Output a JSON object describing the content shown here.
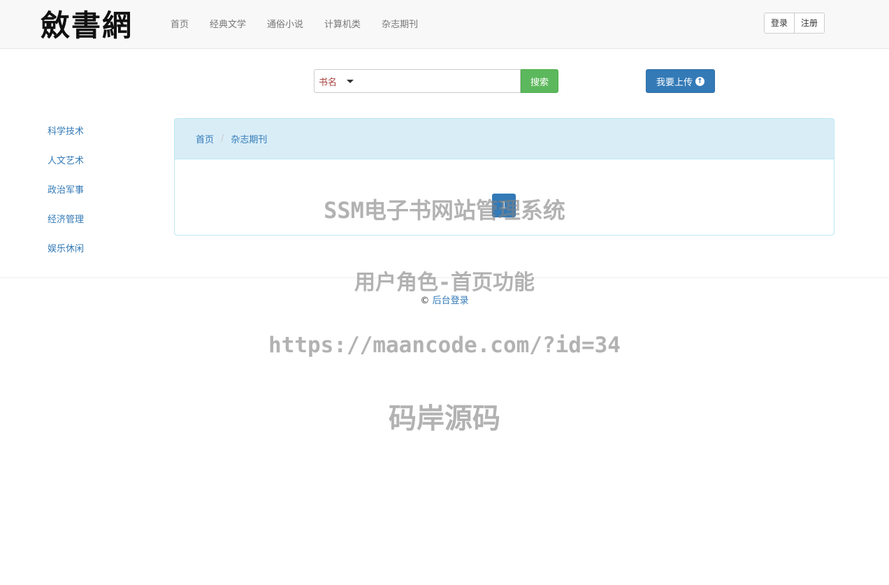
{
  "header": {
    "logo_text": "斂書網",
    "nav": [
      "首页",
      "经典文学",
      "通俗小说",
      "计算机类",
      "杂志期刊"
    ],
    "login_label": "登录",
    "register_label": "注册"
  },
  "search": {
    "type_label": "书名",
    "input_value": "",
    "placeholder": "",
    "button_label": "搜索"
  },
  "upload": {
    "label": "我要上传",
    "icon": "arrow-circle-up-icon"
  },
  "sidebar": {
    "items": [
      "科学技术",
      "人文艺术",
      "政治军事",
      "经济管理",
      "娱乐休闲"
    ]
  },
  "breadcrumb": {
    "items": [
      "首页",
      "杂志期刊"
    ],
    "separator": "/"
  },
  "pagination": {
    "current_page": "1"
  },
  "footer": {
    "copyright_symbol": "©",
    "admin_link": "后台登录"
  },
  "watermark": {
    "lines": [
      "SSM电子书网站管理系统",
      "用户角色-首页功能",
      "https://maancode.com/?id=34",
      "码岸源码"
    ]
  },
  "colors": {
    "primary": "#337ab7",
    "success": "#5cb85c",
    "panel_heading": "#d9edf7",
    "search_label": "#a94442",
    "navbar_bg": "#f8f8f8"
  }
}
